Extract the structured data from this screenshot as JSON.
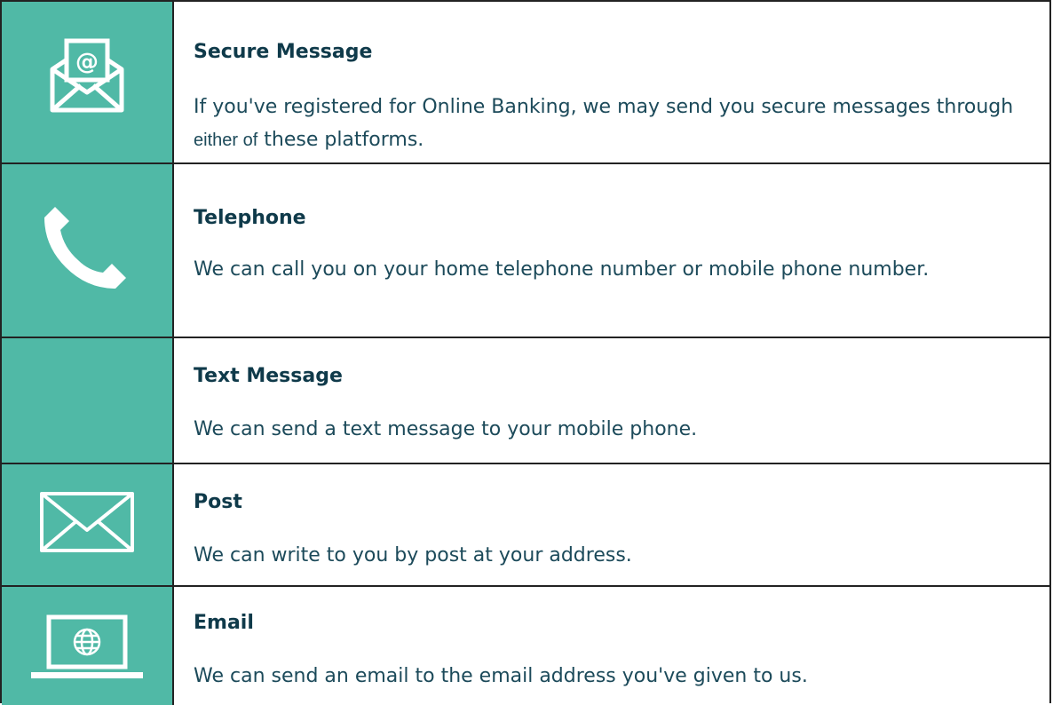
{
  "colors": {
    "icon_bg": "#50b9a6",
    "title_color": "#0f3a4a",
    "text_color": "#1c4a5a",
    "border": "#222222"
  },
  "rows": [
    {
      "icon": "envelope-at-icon",
      "title": "Secure Message",
      "desc_part1": "If you've registered for Online Banking, we may send you secure messages through ",
      "desc_part2": "either of",
      "desc_part3": " these platforms."
    },
    {
      "icon": "telephone-handset-icon",
      "title": "Telephone",
      "desc": "We can call you on your home telephone number or mobile phone number."
    },
    {
      "icon": "",
      "title": "Text Message",
      "desc": "We can send a text message to your mobile phone."
    },
    {
      "icon": "envelope-icon",
      "title": "Post",
      "desc": "We can write to you by post at your address."
    },
    {
      "icon": "laptop-globe-icon",
      "title": "Email",
      "desc": "We can send an email to the email address you've given to us."
    }
  ]
}
